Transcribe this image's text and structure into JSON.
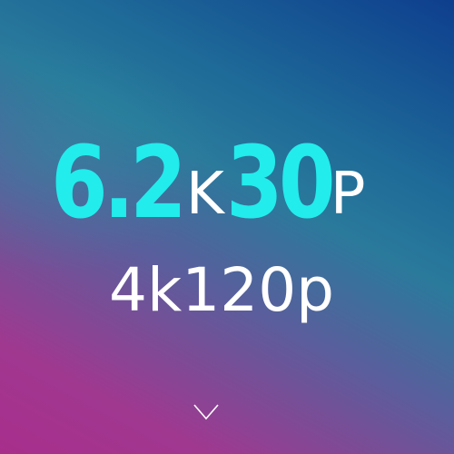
{
  "primary_mode": {
    "resolution_value": "6.2",
    "resolution_unit": "K",
    "fps_value": "30",
    "fps_unit": "P"
  },
  "secondary_mode": {
    "label": "4k120p"
  },
  "icons": {
    "expand": "chevron-down-icon"
  }
}
